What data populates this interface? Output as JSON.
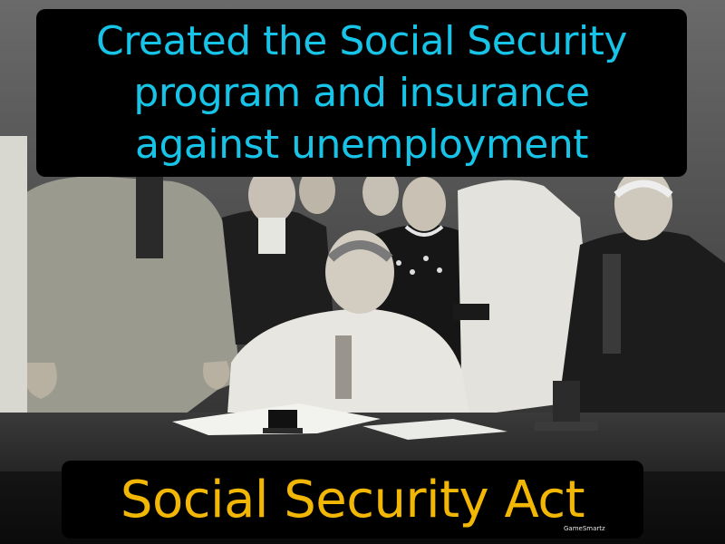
{
  "caption": {
    "lines": [
      "Created the Social Security",
      "program and insurance",
      "against unemployment"
    ]
  },
  "term": "Social Security Act",
  "brand": "GameSmartz",
  "colors": {
    "caption_text": "#17c4e8",
    "term_text": "#f2b705",
    "label_background": "#000000"
  }
}
